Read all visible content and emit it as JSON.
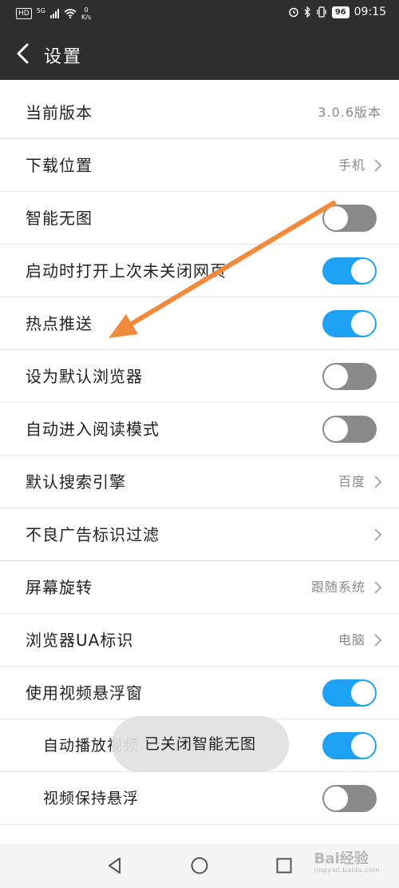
{
  "status_bar": {
    "hd": "HD",
    "network": "5G",
    "speed_value": "0",
    "speed_unit": "K/s",
    "battery": "96",
    "time": "09:15"
  },
  "header": {
    "title": "设置"
  },
  "settings": [
    {
      "label": "当前版本",
      "value": "3.0.6版本",
      "control": "text"
    },
    {
      "label": "下载位置",
      "value": "手机",
      "control": "link"
    },
    {
      "label": "智能无图",
      "control": "toggle",
      "on": false
    },
    {
      "label": "启动时打开上次未关闭网页",
      "control": "toggle",
      "on": true
    },
    {
      "label": "热点推送",
      "control": "toggle",
      "on": true
    },
    {
      "label": "设为默认浏览器",
      "control": "toggle",
      "on": false
    },
    {
      "label": "自动进入阅读模式",
      "control": "toggle",
      "on": false
    },
    {
      "label": "默认搜索引擎",
      "value": "百度",
      "control": "link"
    },
    {
      "label": "不良广告标识过滤",
      "value": "",
      "control": "link"
    },
    {
      "label": "屏幕旋转",
      "value": "跟随系统",
      "control": "link"
    },
    {
      "label": "浏览器UA标识",
      "value": "电脑",
      "control": "link"
    },
    {
      "label": "使用视频悬浮窗",
      "control": "toggle",
      "on": true
    },
    {
      "label": "自动播放视频",
      "control": "toggle",
      "on": true,
      "sub": true
    },
    {
      "label": "视频保持悬浮",
      "control": "toggle",
      "on": false,
      "sub": true
    }
  ],
  "toast": "已关闭智能无图",
  "watermark": {
    "text": "Bai经验",
    "sub": "jingyan.baidu.com"
  },
  "colors": {
    "accent": "#1da1f2",
    "header_bg": "#2e2e2e",
    "annotation_arrow": "#f08a3c"
  }
}
